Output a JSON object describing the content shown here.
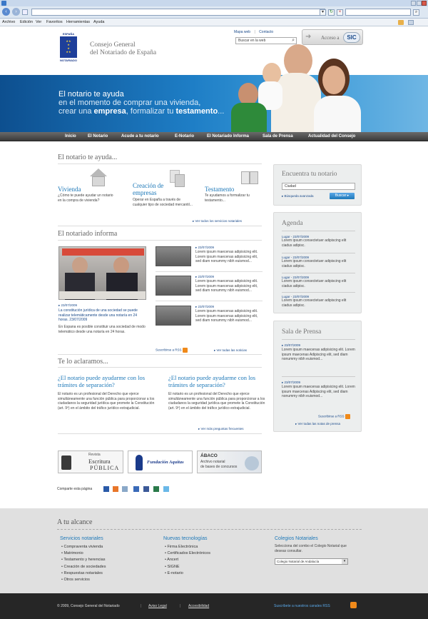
{
  "browser": {
    "menu": [
      "Archivo",
      "Edición",
      "Ver",
      "Favoritos",
      "Herramientas",
      "Ayuda"
    ]
  },
  "header": {
    "logo_text_top": "ESPAÑA",
    "logo_text_bottom": "NOTARIADO",
    "site_title_line1": "Consejo General",
    "site_title_line2": "del Notariado de España",
    "util_links": [
      "Mapa web",
      "Contacto"
    ],
    "search_placeholder": "Buscar en la web",
    "access_label": "Acceso a",
    "access_brand": "SIC"
  },
  "hero": {
    "line1": "El notario te ayuda",
    "line2": "en el momento de comprar una vivienda,",
    "line3_pre": "crear una ",
    "line3_b1": "empresa",
    "line3_mid": ", formalizar tu ",
    "line3_b2": "testamento",
    "line3_post": "..."
  },
  "nav": [
    "Inicio",
    "El Notario",
    "Acude a tu notario",
    "E-Notario",
    "El Notariado Informa",
    "Sala de Prensa",
    "Actualidad del Consejo"
  ],
  "ayuda": {
    "title": "El notario te ayuda...",
    "cards": [
      {
        "title": "Vivienda",
        "text": "¿Cómo te puede ayudar un notario en la compra de vivienda?"
      },
      {
        "title": "Creación de empresas",
        "text": "Operar en España a través de cualquier tipo de sociedad mercantil..."
      },
      {
        "title": "Testamento",
        "text": "Te ayudamos a formalizar tu testamento..."
      }
    ],
    "more_link": "Ver todos los servicios notariales"
  },
  "informa": {
    "title": "El notariado informa",
    "main_date": "23/07/2009",
    "main_text": "La constitución jurídica de una sociedad se puede realizar telemáticamente desde una notaría en 24 horas. 23/07/2009",
    "main_text2": "En Espana es posible constituir una sociedad de modo telemático desde una notaría en 24 horas.",
    "items": [
      {
        "date": "23/07/2009",
        "text": "Lorem ipsum maecenas adipisicing elit. Lorem ipsum maecenas adipisicing elit, sed diam nonummy nibh euismod..."
      },
      {
        "date": "23/07/2009",
        "text": "Lorem ipsum maecenas adipisicing elit. Lorem ipsum maecenas adipisicing elit, sed diam nonummy nibh euismod..."
      },
      {
        "date": "23/07/2009",
        "text": "Lorem ipsum maecenas adipisicing elit. Lorem ipsum maecenas adipisicing elit, sed diam nonummy nibh euismod..."
      }
    ],
    "rss_link": "Suscribirse a RSS",
    "more_link": "Ver todas las noticias"
  },
  "aclaramos": {
    "title": "Te lo aclaramos...",
    "cols": [
      {
        "title": "¿El notario puede ayudarme con los trámites de separación?",
        "text": "El notario es un profesional del Derecho que ejerce simultáneamente una función pública para proporcionar a los ciudadanos la seguridad jurídica que promete la Constitución (art. 9º) en el ámbito del tráfico jurídico extrajudicial."
      },
      {
        "title": "¿El notario puede ayudarme con los trámites de separación?",
        "text": "El notario es un profesional del Derecho que ejerce simultáneamente una función pública para proporcionar a los ciudadanos la seguridad jurídica que promete la Constitución (art. 9º) en el ámbito del tráfico jurídico extrajudicial."
      }
    ],
    "more_link": "Ver más preguntas frecuentes"
  },
  "banners": {
    "revista_small": "Revista",
    "revista_big1": "Escritura",
    "revista_big2": "PÚBLICA",
    "fundacion": "Fundación Aquitas",
    "abaco_title": "ÁBACO",
    "abaco_sub1": "Archivo notarial",
    "abaco_sub2": "de bases de concursos"
  },
  "share_label": "Comparte esta página",
  "sidebar": {
    "encuentra": {
      "title": "Encuentra tu notario",
      "placeholder": "Ciudad",
      "adv_link": "Búsqueda avanzada",
      "button": "Buscar"
    },
    "agenda": {
      "title": "Agenda",
      "items": [
        {
          "head": "Lugar - 23/07/2009",
          "text": "Lorem ipsum consectetuer adipiscing elit ciadus adipisc."
        },
        {
          "head": "Lugar - 23/07/2009",
          "text": "Lorem ipsum consectetuer adipiscing elit ciadus adipisc."
        },
        {
          "head": "Lugar - 23/07/2009",
          "text": "Lorem ipsum consectetuer adipiscing elit ciadus adipisc."
        },
        {
          "head": "Lugar - 23/07/2009",
          "text": "Lorem ipsum consectetuer adipiscing elit ciadus adipisc."
        }
      ]
    },
    "prensa": {
      "title": "Sala de Prensa",
      "items": [
        {
          "date": "23/07/2009",
          "text": "Lorem ipsum maecenas adipisicing elit. Lorem ipsum maecenas Adipiscing elit, sed diam nonummy nibh euismod..."
        },
        {
          "date": "23/07/2009",
          "text": "Lorem ipsum maecenas adipisicing elit. Lorem ipsum maecenas Adipiscing elit, sed diam nonummy nibh euismod..."
        }
      ],
      "rss_link": "Suscribirse a RSS",
      "more_link": "Ver todas las notas de prensa"
    }
  },
  "footer": {
    "title": "A tu alcance",
    "servicios": {
      "title": "Servicios notariales",
      "items": [
        "Compraventa vivienda",
        "Matrimonio",
        "Testamento y herencias",
        "Creación de sociedades",
        "Respuestas notariales",
        "Otros servicios"
      ]
    },
    "tecnologias": {
      "title": "Nuevas tecnologías",
      "items": [
        "Firma Electrónica",
        "Certificados Electrónicos",
        "Ancert",
        "SIGNE",
        "E-notario"
      ]
    },
    "colegios": {
      "title": "Colegios Notariales",
      "text": "Selecciona del combo el Colegio Notarial que deseas consultar.",
      "select": "Colegio Notarial de Andalucía"
    },
    "copyright": "© 2009, Consejo General del Notariado",
    "aviso": "Aviso Legal",
    "accesibilidad": "Accesibilidad",
    "rss": "Suscribete a nuestros canales RSS"
  },
  "colors": {
    "accent": "#1d78b8",
    "hero": "#1e7ec6",
    "nav": "#4a4a4a",
    "footer_dark": "#262626"
  }
}
